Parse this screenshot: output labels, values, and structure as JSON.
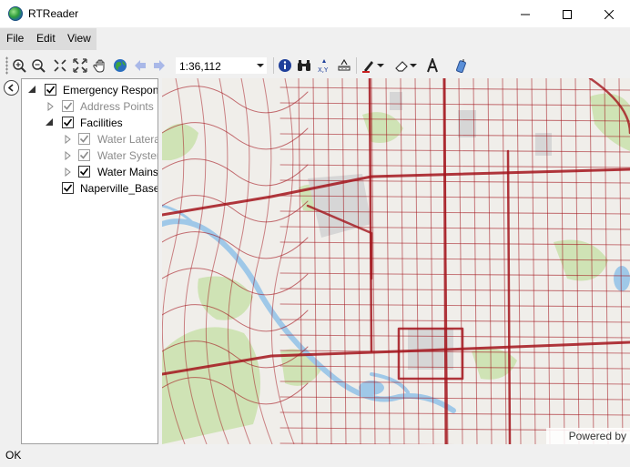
{
  "window": {
    "title": "RTReader",
    "icon": "globe-icon"
  },
  "menu": {
    "items": [
      "File",
      "Edit",
      "View"
    ]
  },
  "toolbar": {
    "scale": "1:36,112",
    "tools": [
      "zoom-in-icon",
      "zoom-out-icon",
      "fixed-zoom-in-icon",
      "full-extent-icon",
      "pan-icon",
      "globe-icon",
      "back-icon",
      "forward-icon",
      "identify-icon",
      "find-icon",
      "xy-icon",
      "measure-icon",
      "draw-icon",
      "eraser-icon",
      "text-icon",
      "gps-icon"
    ]
  },
  "toc": {
    "items": [
      {
        "label": "Emergency Response",
        "level": 0,
        "expanded": true,
        "checked": true,
        "dimmed": false
      },
      {
        "label": "Address Points",
        "level": 1,
        "expanded": false,
        "checked": true,
        "dimmed": true
      },
      {
        "label": "Facilities",
        "level": 1,
        "expanded": true,
        "checked": true,
        "dimmed": false
      },
      {
        "label": "Water Laterals",
        "level": 2,
        "expanded": false,
        "checked": true,
        "dimmed": true
      },
      {
        "label": "Water System",
        "level": 2,
        "expanded": false,
        "checked": true,
        "dimmed": true
      },
      {
        "label": "Water Mains",
        "level": 2,
        "expanded": false,
        "checked": true,
        "dimmed": false
      },
      {
        "label": "Naperville_Basemap",
        "level": 0,
        "expanded": null,
        "checked": true,
        "dimmed": false
      }
    ]
  },
  "map": {
    "attribution": "Powered by Esri"
  },
  "status": {
    "text": "OK"
  },
  "colors": {
    "water_main": "#a3141c",
    "river": "#9fc8e8",
    "park": "#cfe3b5",
    "building": "#d6d6d6"
  }
}
